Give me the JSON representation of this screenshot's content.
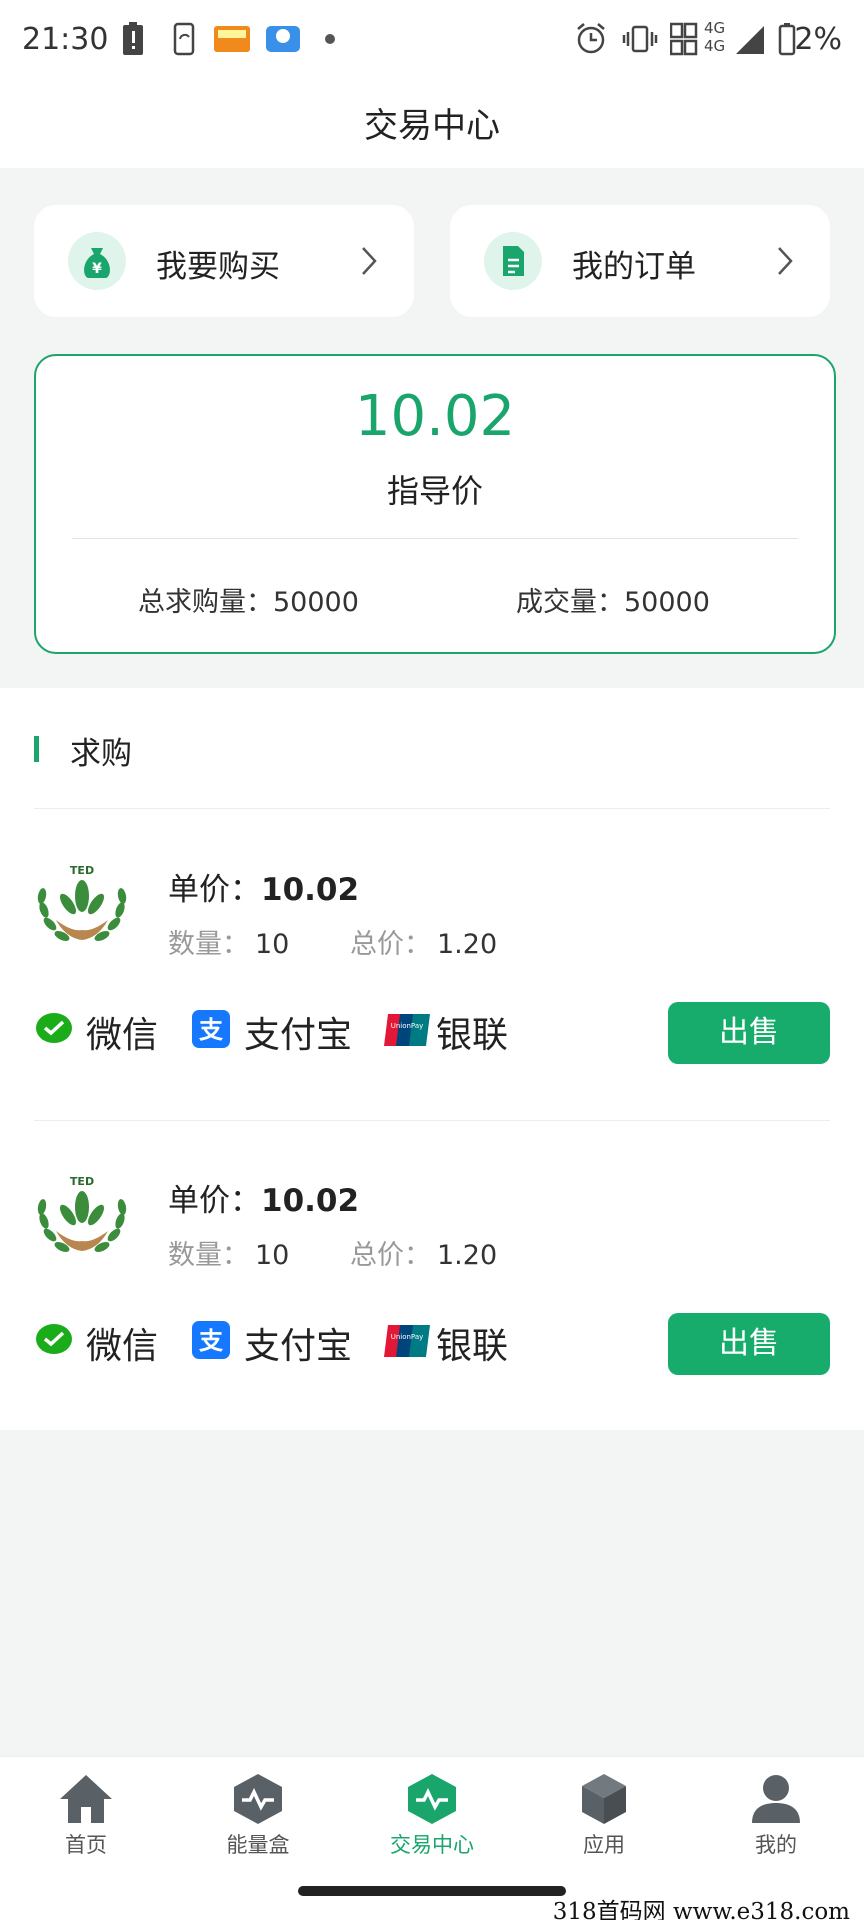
{
  "status_bar": {
    "time": "21:30",
    "network_label": "4G",
    "battery_percent": "2%",
    "icons": [
      "alert-icon",
      "phone-sync-icon",
      "app-notification-icon",
      "app-notification-icon",
      "dot-icon",
      "alarm-icon",
      "vibrate-icon",
      "data-icon",
      "signal-icon",
      "battery-icon"
    ]
  },
  "header": {
    "title": "交易中心"
  },
  "quick_actions": [
    {
      "label": "我要购买",
      "icon": "money-bag-icon"
    },
    {
      "label": "我的订单",
      "icon": "document-icon"
    }
  ],
  "price_summary": {
    "value": "10.02",
    "label": "指导价",
    "total_demand_label": "总求购量：",
    "total_demand_value": "50000",
    "volume_label": "成交量：",
    "volume_value": "50000"
  },
  "section": {
    "title": "求购"
  },
  "orders": [
    {
      "unit_label": "单价：",
      "unit_price": "10.02",
      "qty_label": "数量：",
      "qty": "10",
      "total_label": "总价：",
      "total": "1.20",
      "payments": [
        "微信",
        "支付宝",
        "银联"
      ],
      "action": "出售"
    },
    {
      "unit_label": "单价：",
      "unit_price": "10.02",
      "qty_label": "数量：",
      "qty": "10",
      "total_label": "总价：",
      "total": "1.20",
      "payments": [
        "微信",
        "支付宝",
        "银联"
      ],
      "action": "出售"
    }
  ],
  "logo_text": "TED",
  "unionpay_text": "UnionPay",
  "bottom_nav": [
    {
      "label": "首页",
      "icon": "home-icon",
      "active": false
    },
    {
      "label": "能量盒",
      "icon": "energy-box-icon",
      "active": false
    },
    {
      "label": "交易中心",
      "icon": "trade-center-icon",
      "active": true
    },
    {
      "label": "应用",
      "icon": "cube-icon",
      "active": false
    },
    {
      "label": "我的",
      "icon": "user-icon",
      "active": false
    }
  ],
  "watermark": "318首码网  www.e318.com",
  "colors": {
    "accent": "#19a56c",
    "button": "#17ac6c",
    "background": "#f2f5f4"
  }
}
